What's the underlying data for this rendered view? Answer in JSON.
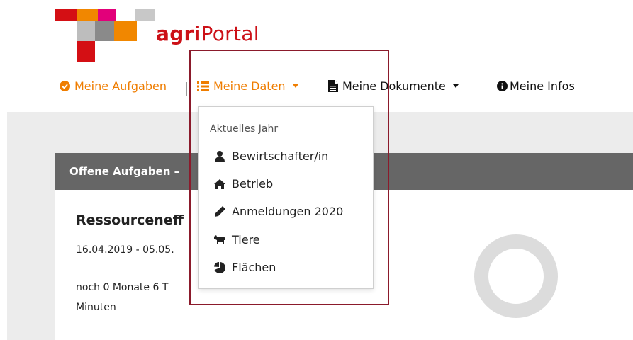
{
  "brand": {
    "name_bold": "agri",
    "name_light": "Portal",
    "color": "#cc1017",
    "accent": "#ef7d00"
  },
  "nav": {
    "items": [
      {
        "label": "Meine Aufgaben",
        "icon": "check-circle-icon",
        "color": "#ef7d00"
      },
      {
        "label": "Meine Daten",
        "icon": "list-icon",
        "color": "#ef7d00"
      },
      {
        "label": "Meine Dokumente",
        "icon": "file-icon",
        "color": "#111111"
      },
      {
        "label": "Meine Infos",
        "icon": "info-circle-icon",
        "color": "#111111"
      }
    ]
  },
  "dropdown": {
    "header": "Aktuelles Jahr",
    "items": [
      {
        "label": "Bewirtschafter/in",
        "icon": "user-icon"
      },
      {
        "label": "Betrieb",
        "icon": "home-icon"
      },
      {
        "label": "Anmeldungen 2020",
        "icon": "pencil-icon"
      },
      {
        "label": "Tiere",
        "icon": "cow-icon"
      },
      {
        "label": "Flächen",
        "icon": "pie-chart-icon"
      }
    ]
  },
  "panel": {
    "header": "Offene Aufgaben –",
    "task_title": "Ressourceneff",
    "task_date": "16.04.2019 - 05.05.",
    "task_remaining": "noch 0 Monate 6 T",
    "task_remaining_2": "Minuten"
  }
}
